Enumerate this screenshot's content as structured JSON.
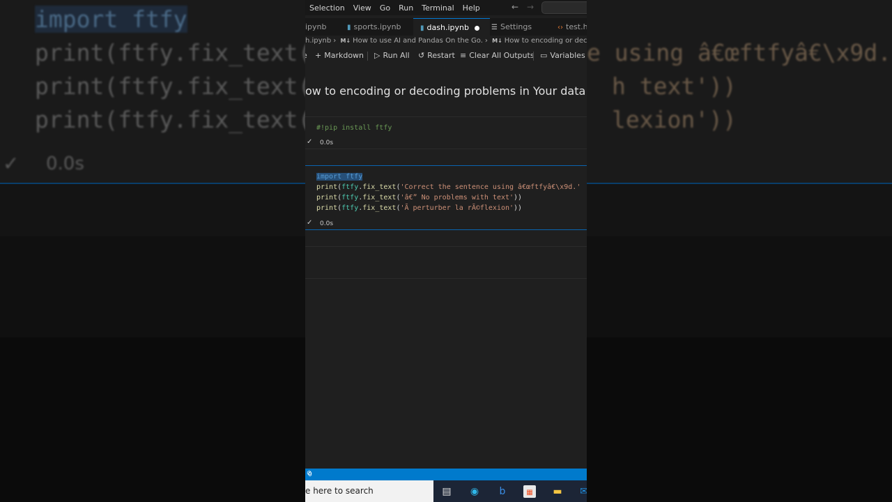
{
  "background_code": {
    "line1": "import ftfy",
    "line2_prefix": "print(ftfy.fix_text(",
    "line2_right": "e using â€œftfyâ€\\x9d.",
    "line3_prefix": "print(ftfy.fix_text(",
    "line3_right": "h text'))",
    "line4_prefix": "print(ftfy.fix_text(",
    "line4_right": "lexion'))",
    "exec_time": "0.0s"
  },
  "menu": {
    "items": [
      "Selection",
      "View",
      "Go",
      "Run",
      "Terminal",
      "Help"
    ]
  },
  "tabs": [
    {
      "label": "ipynb"
    },
    {
      "label": "sports.ipynb"
    },
    {
      "label": "dash.ipynb"
    },
    {
      "label": "Settings"
    },
    {
      "label": "test.ht"
    }
  ],
  "breadcrumbs": {
    "file": "h.ipynb",
    "md1_badge": "M↓",
    "md1": "How to use AI and Pandas On the Go.",
    "md2_badge": "M↓",
    "md2": "How to encoding or decoding p"
  },
  "toolbar": {
    "markdown": "Markdown",
    "run_all": "Run All",
    "restart": "Restart",
    "clear_all": "Clear All Outputs",
    "variables": "Variables"
  },
  "heading": "ow to encoding or decoding problems in Your data",
  "cell1": {
    "code": "#!pip install ftfy",
    "time": "0.0s"
  },
  "cell2": {
    "line1": "import ftfy",
    "line2_fn": "print",
    "line2_mod": "ftfy",
    "line2_call": "fix_text",
    "line2_str": "'Correct the sentence using â€œftfyâ€\\x9d.'",
    "line3_fn": "print",
    "line3_mod": "ftfy",
    "line3_call": "fix_text",
    "line3_str": "'â€” No problems with text'",
    "line4_fn": "print",
    "line4_mod": "ftfy",
    "line4_call": "fix_text",
    "line4_str": "'Ã perturber la rÃ©flexion'",
    "time": "0.0s"
  },
  "statusbar": {
    "text": "0"
  },
  "taskbar": {
    "search_text": "e here to search"
  }
}
